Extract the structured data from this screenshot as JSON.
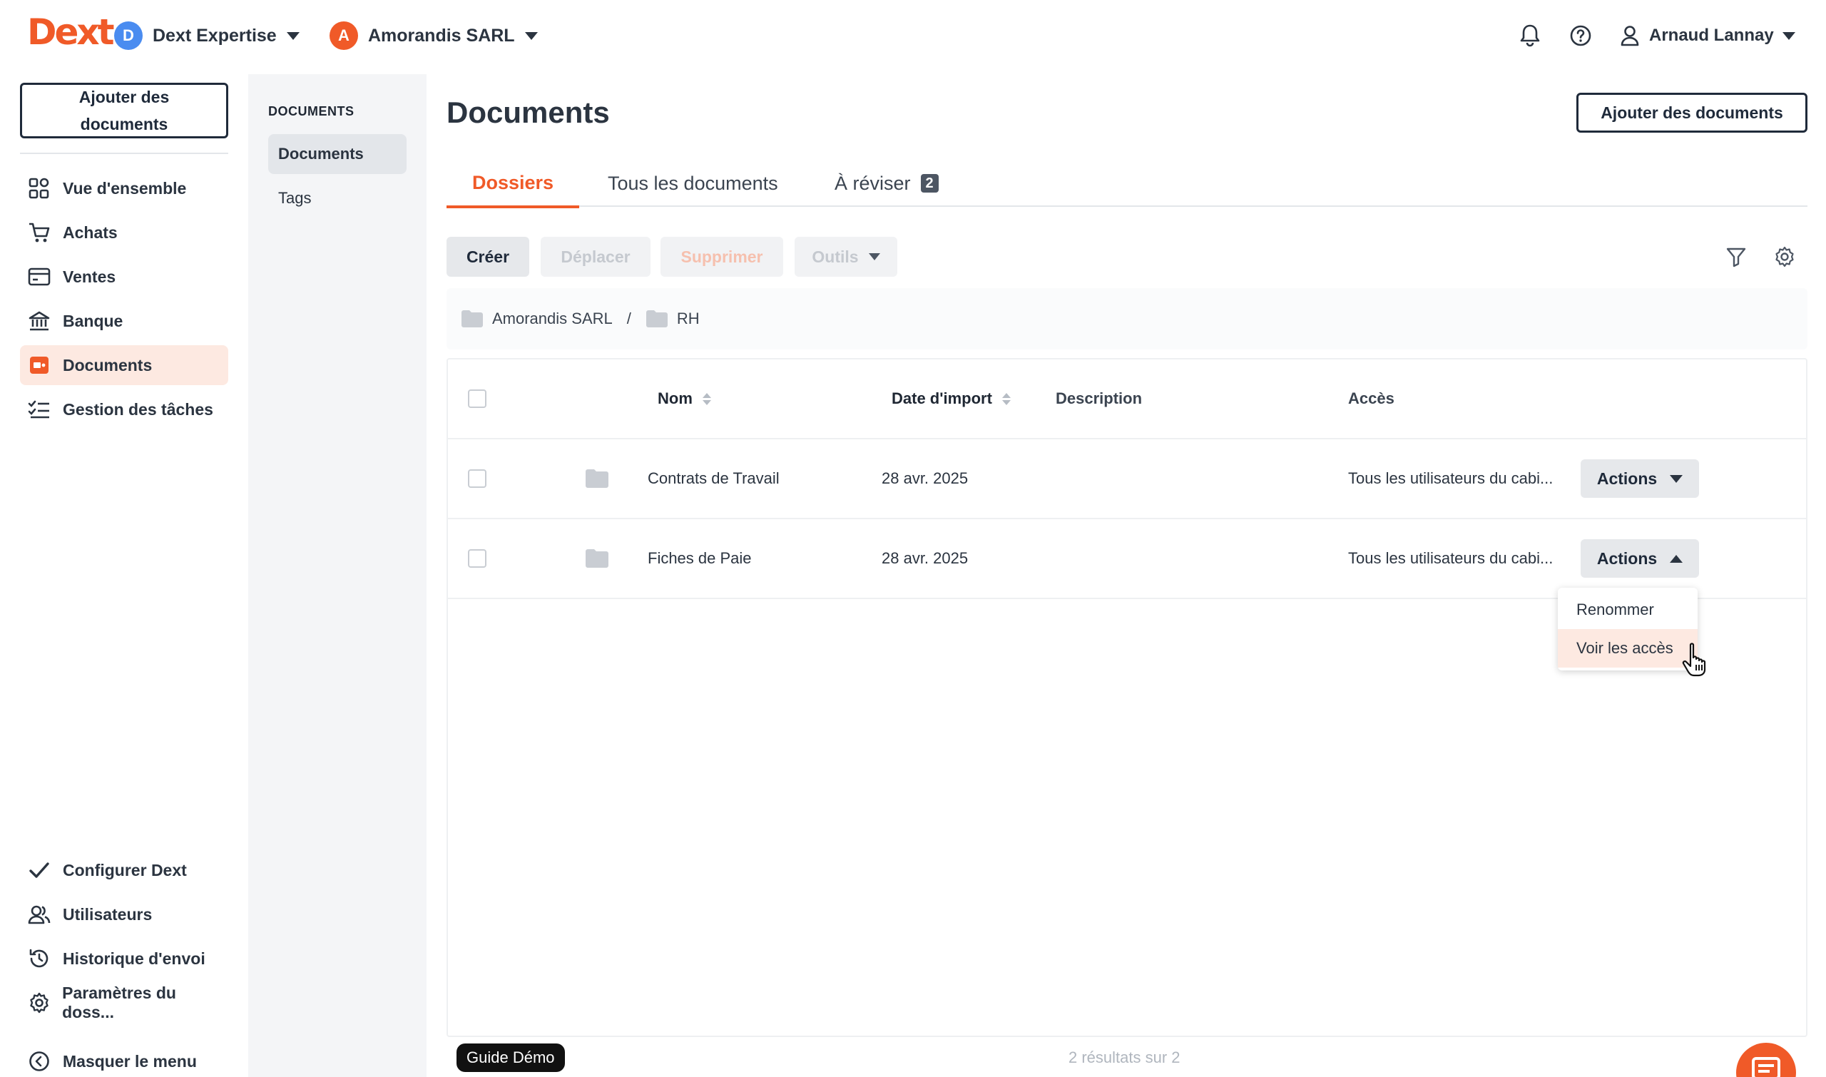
{
  "app": {
    "logo": "Dext",
    "brand_color": "#f05a28"
  },
  "topbar": {
    "practice": {
      "initial": "D",
      "name": "Dext Expertise",
      "color": "#4a8cf0"
    },
    "client": {
      "initial": "A",
      "name": "Amorandis SARL",
      "color": "#f05a28"
    },
    "user": {
      "name": "Arnaud Lannay"
    }
  },
  "sidebar": {
    "add_documents_line1": "Ajouter des",
    "add_documents_line2": "documents",
    "items": [
      {
        "label": "Vue d'ensemble",
        "icon": "overview-icon"
      },
      {
        "label": "Achats",
        "icon": "cart-icon"
      },
      {
        "label": "Ventes",
        "icon": "card-icon"
      },
      {
        "label": "Banque",
        "icon": "bank-icon"
      },
      {
        "label": "Documents",
        "icon": "documents-icon",
        "active": true
      },
      {
        "label": "Gestion des tâches",
        "icon": "tasks-icon"
      }
    ],
    "bottom_items": [
      {
        "label": "Configurer Dext",
        "icon": "check-icon"
      },
      {
        "label": "Utilisateurs",
        "icon": "users-icon"
      },
      {
        "label": "Historique d'envoi",
        "icon": "history-icon"
      },
      {
        "label": "Paramètres du doss...",
        "icon": "settings-icon"
      }
    ],
    "hide_menu": "Masquer le menu"
  },
  "subnav": {
    "title": "DOCUMENTS",
    "items": [
      {
        "label": "Documents",
        "active": true
      },
      {
        "label": "Tags"
      }
    ]
  },
  "main": {
    "title": "Documents",
    "add_documents": "Ajouter des documents",
    "tabs": [
      {
        "label": "Dossiers",
        "active": true
      },
      {
        "label": "Tous les documents"
      },
      {
        "label": "À réviser",
        "badge": "2"
      }
    ],
    "toolbar": {
      "create": "Créer",
      "move": "Déplacer",
      "delete": "Supprimer",
      "tools": "Outils"
    },
    "breadcrumb": [
      "Amorandis SARL",
      "/",
      "RH"
    ],
    "table": {
      "columns": [
        "Nom",
        "Date d'import",
        "Description",
        "Accès"
      ],
      "rows": [
        {
          "name": "Contrats de Travail",
          "date": "28 avr. 2025",
          "description": "",
          "access": "Tous les utilisateurs du cabi...",
          "action": "Actions"
        },
        {
          "name": "Fiches de Paie",
          "date": "28 avr. 2025",
          "description": "",
          "access": "Tous les utilisateurs du cabi...",
          "action": "Actions"
        }
      ]
    },
    "actions_menu": [
      "Renommer",
      "Voir les accès"
    ],
    "results": "2 résultats sur 2",
    "guide": "Guide Démo"
  }
}
